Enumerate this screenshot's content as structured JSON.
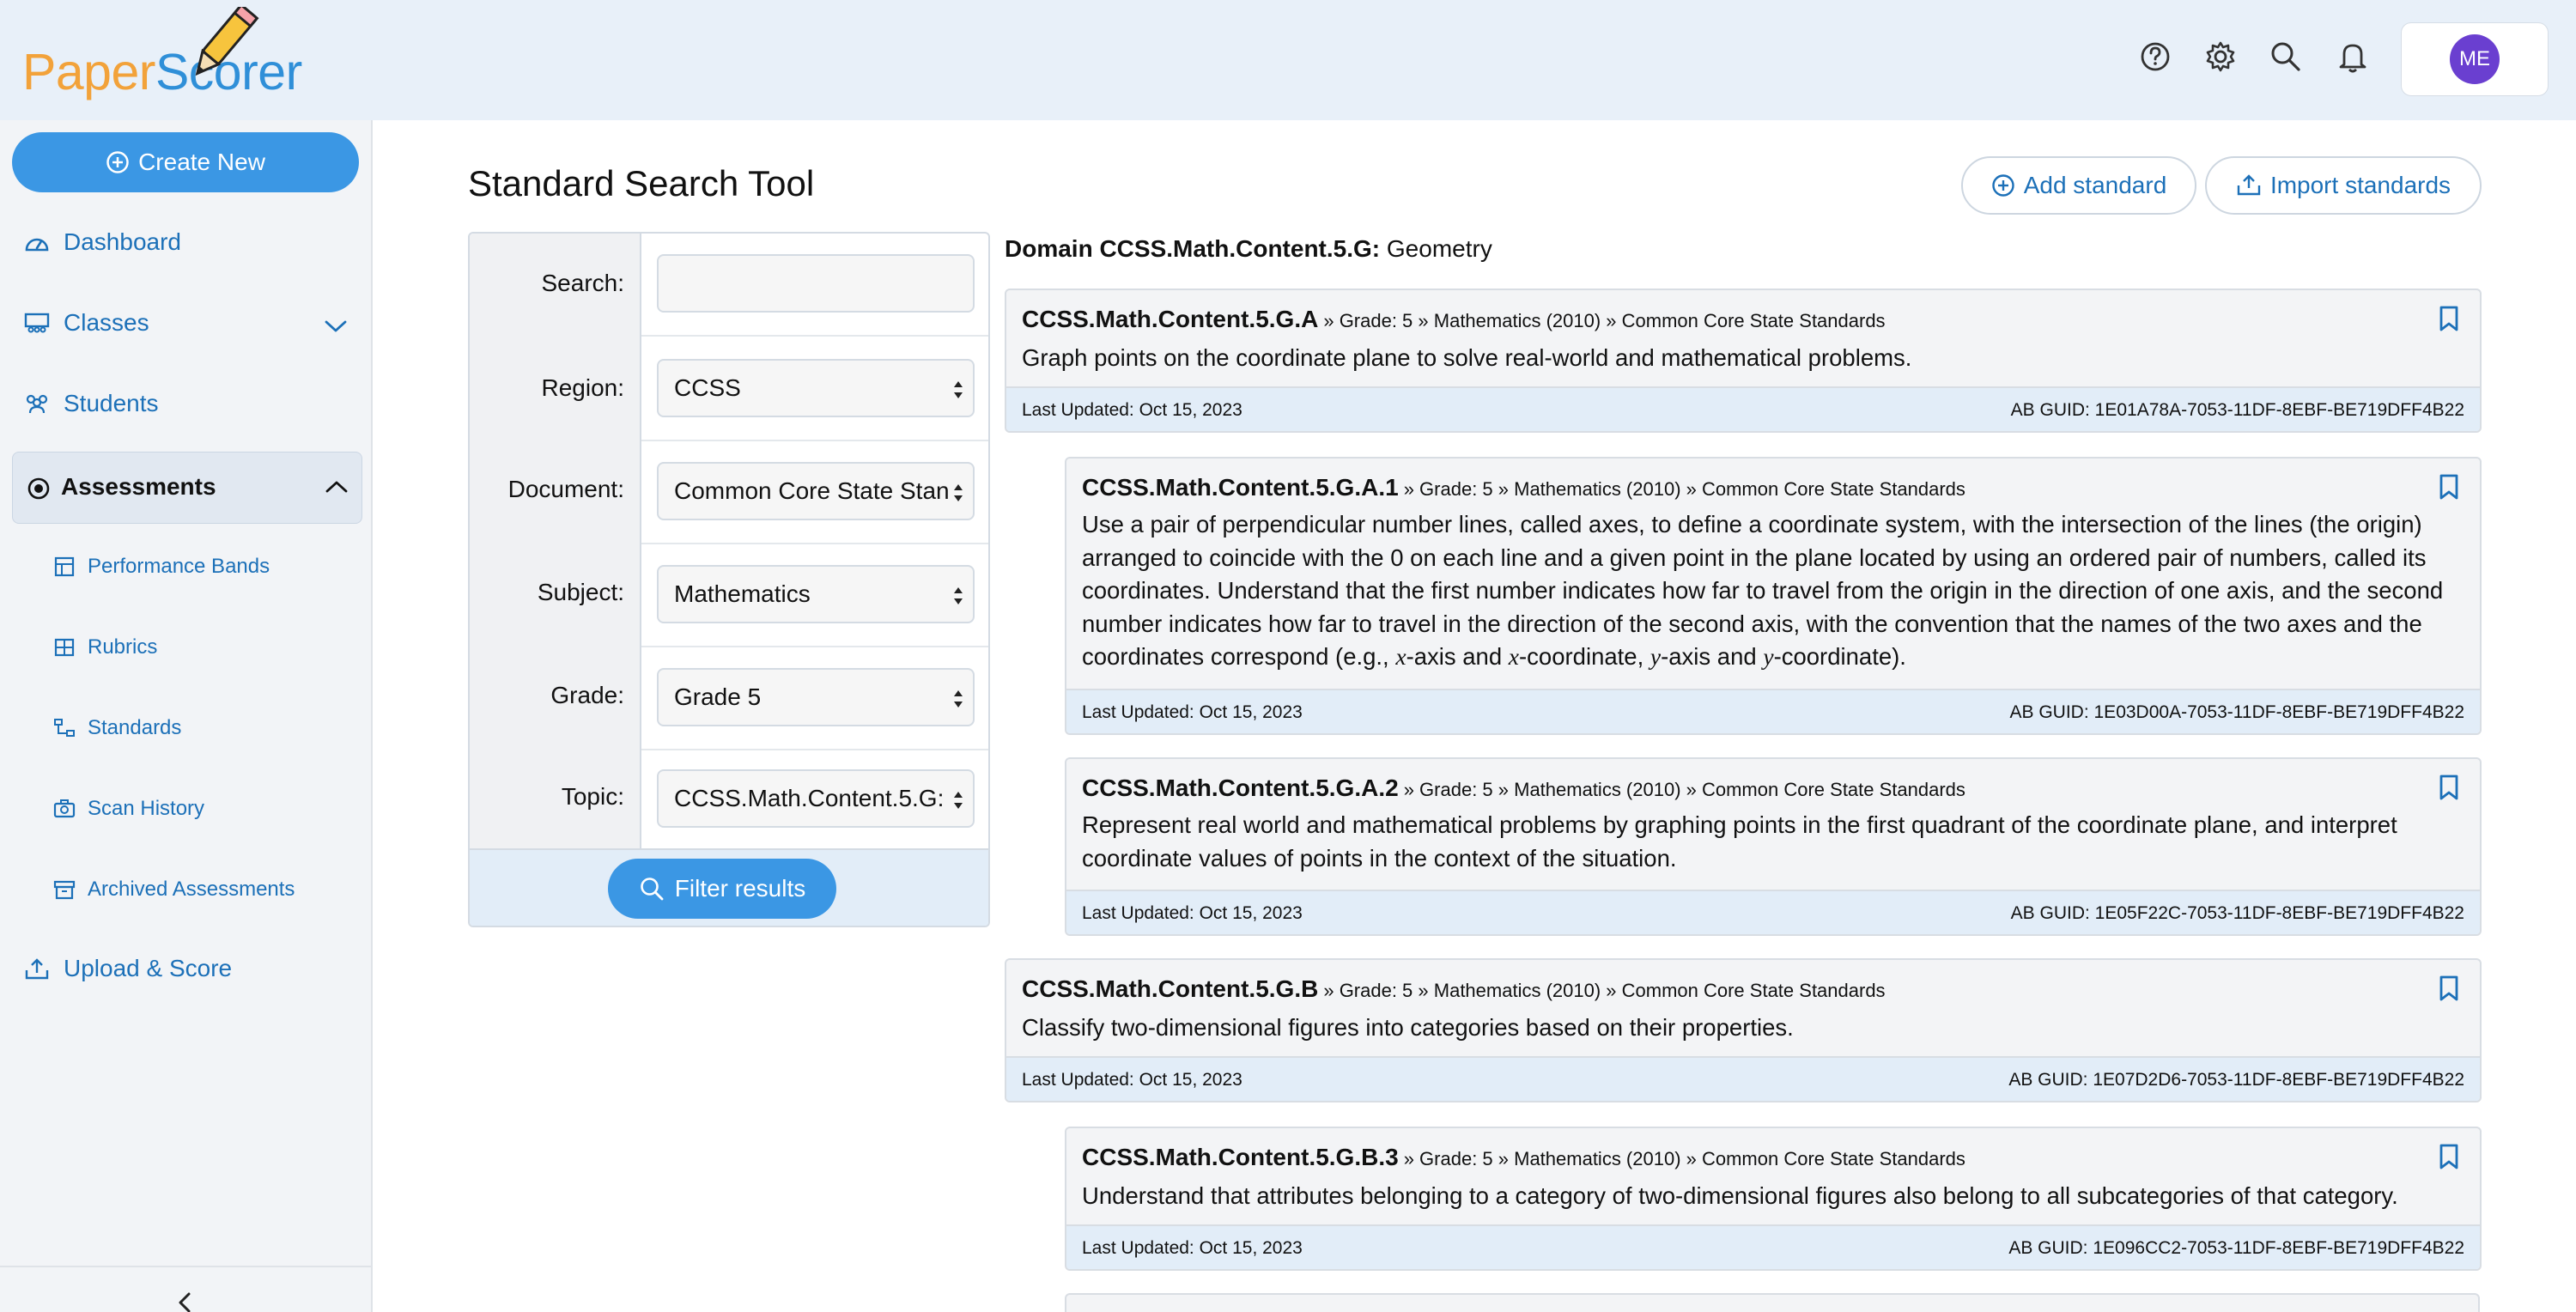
{
  "app": {
    "logo_part1": "Paper",
    "logo_part2": "Scorer"
  },
  "topbar": {
    "icons": [
      "help-icon",
      "settings-icon",
      "search-icon",
      "bell-icon"
    ],
    "avatar_initials": "ME"
  },
  "sidebar": {
    "create_label": "Create New",
    "dashboard": "Dashboard",
    "classes": "Classes",
    "students": "Students",
    "assessments": "Assessments",
    "sub_items": [
      "Performance Bands",
      "Rubrics",
      "Standards",
      "Scan History",
      "Archived Assessments"
    ],
    "upload": "Upload & Score"
  },
  "main": {
    "title": "Standard Search Tool",
    "add_standard": "Add standard",
    "import_standards": "Import standards"
  },
  "filter": {
    "search_label": "Search:",
    "search_value": "",
    "region_label": "Region:",
    "region_value": "CCSS",
    "document_label": "Document:",
    "document_value": "Common Core State Stan",
    "subject_label": "Subject:",
    "subject_value": "Mathematics",
    "grade_label": "Grade:",
    "grade_value": "Grade 5",
    "topic_label": "Topic:",
    "topic_value": "CCSS.Math.Content.5.G:",
    "filter_button": "Filter results"
  },
  "results": {
    "domain_prefix": "Domain CCSS.Math.Content.5.G:",
    "domain_name": "Geometry",
    "last_updated_label": "Last Updated: Oct 15, 2023",
    "cards": [
      {
        "code": "CCSS.Math.Content.5.G.A",
        "meta": "» Grade: 5 » Mathematics (2010) » Common Core State Standards",
        "desc": "Graph points on the coordinate plane to solve real-world and mathematical problems.",
        "guid": "AB GUID: 1E01A78A-7053-11DF-8EBF-BE719DFF4B22"
      },
      {
        "code": "CCSS.Math.Content.5.G.A.1",
        "meta": "» Grade: 5 » Mathematics (2010) » Common Core State Standards",
        "desc_1": "Use a pair of perpendicular number lines, called axes, to define a coordinate system, with the intersection of the lines (the origin) arranged to coincide with the 0 on each line and a given point in the plane located by using an ordered pair of numbers, called its coordinates. Understand that the first number indicates how far to travel from the origin in the direction of one axis, and the second number indicates how far to travel in the direction of the second axis, with the convention that the names of the two axes and the coordinates correspond (e.g., ",
        "desc_x1": "x",
        "desc_2": "-axis and ",
        "desc_x2": "x",
        "desc_3": "-coordinate, ",
        "desc_y1": "y",
        "desc_4": "-axis and ",
        "desc_y2": "y",
        "desc_5": "-coordinate).",
        "guid": "AB GUID: 1E03D00A-7053-11DF-8EBF-BE719DFF4B22"
      },
      {
        "code": "CCSS.Math.Content.5.G.A.2",
        "meta": "» Grade: 5 » Mathematics (2010) » Common Core State Standards",
        "desc": "Represent real world and mathematical problems by graphing points in the first quadrant of the coordinate plane, and interpret coordinate values of points in the context of the situation.",
        "guid": "AB GUID: 1E05F22C-7053-11DF-8EBF-BE719DFF4B22"
      },
      {
        "code": "CCSS.Math.Content.5.G.B",
        "meta": "» Grade: 5 » Mathematics (2010) » Common Core State Standards",
        "desc": "Classify two-dimensional figures into categories based on their properties.",
        "guid": "AB GUID: 1E07D2D6-7053-11DF-8EBF-BE719DFF4B22"
      },
      {
        "code": "CCSS.Math.Content.5.G.B.3",
        "meta": "» Grade: 5 » Mathematics (2010) » Common Core State Standards",
        "desc": "Understand that attributes belonging to a category of two-dimensional figures also belong to all subcategories of that category.",
        "guid": "AB GUID: 1E096CC2-7053-11DF-8EBF-BE719DFF4B22"
      }
    ]
  },
  "colors": {
    "accent": "#3b97e4",
    "link": "#1c70b8",
    "topbar": "#e8f0f9",
    "sidebar": "#f2f4f7",
    "card_footer": "#e2edf8"
  }
}
